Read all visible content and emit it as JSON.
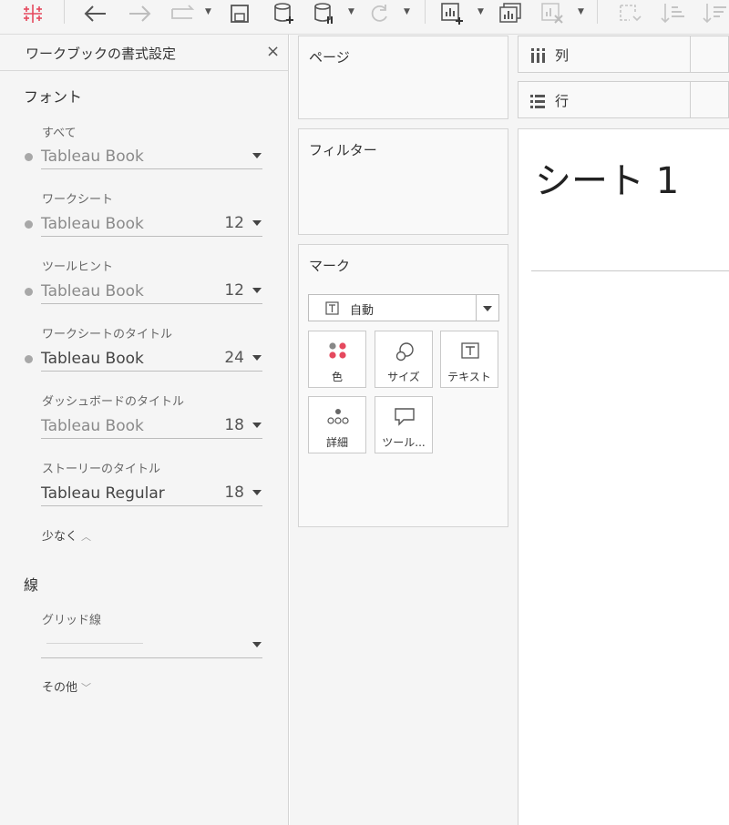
{
  "format_pane": {
    "title": "ワークブックの書式設定",
    "close_label": "×",
    "font_section": {
      "title": "フォント",
      "rows": [
        {
          "label": "すべて",
          "font": "Tableau Book",
          "size": ""
        },
        {
          "label": "ワークシート",
          "font": "Tableau Book",
          "size": "12"
        },
        {
          "label": "ツールヒント",
          "font": "Tableau Book",
          "size": "12"
        },
        {
          "label": "ワークシートのタイトル",
          "font": "Tableau Book",
          "size": "24"
        },
        {
          "label": "ダッシュボードのタイトル",
          "font": "Tableau Book",
          "size": "18"
        },
        {
          "label": "ストーリーのタイトル",
          "font": "Tableau Regular",
          "size": "18"
        }
      ],
      "less_label": "少なく"
    },
    "lines_section": {
      "title": "線",
      "grid_label": "グリッド線",
      "more_label": "その他"
    }
  },
  "shelves": {
    "pages_title": "ページ",
    "filters_title": "フィルター",
    "marks": {
      "title": "マーク",
      "type_value": "自動",
      "buttons": [
        {
          "label": "色",
          "icon": "color-icon"
        },
        {
          "label": "サイズ",
          "icon": "size-icon"
        },
        {
          "label": "テキスト",
          "icon": "text-icon"
        },
        {
          "label": "詳細",
          "icon": "detail-icon"
        },
        {
          "label": "ツール...",
          "icon": "tooltip-icon"
        }
      ]
    }
  },
  "columns_shelf": {
    "label": "列"
  },
  "rows_shelf": {
    "label": "行"
  },
  "sheet": {
    "title": "シート 1"
  },
  "colors": {
    "accent_red": "#e5495e",
    "pane_bg": "#f5f5f5"
  }
}
